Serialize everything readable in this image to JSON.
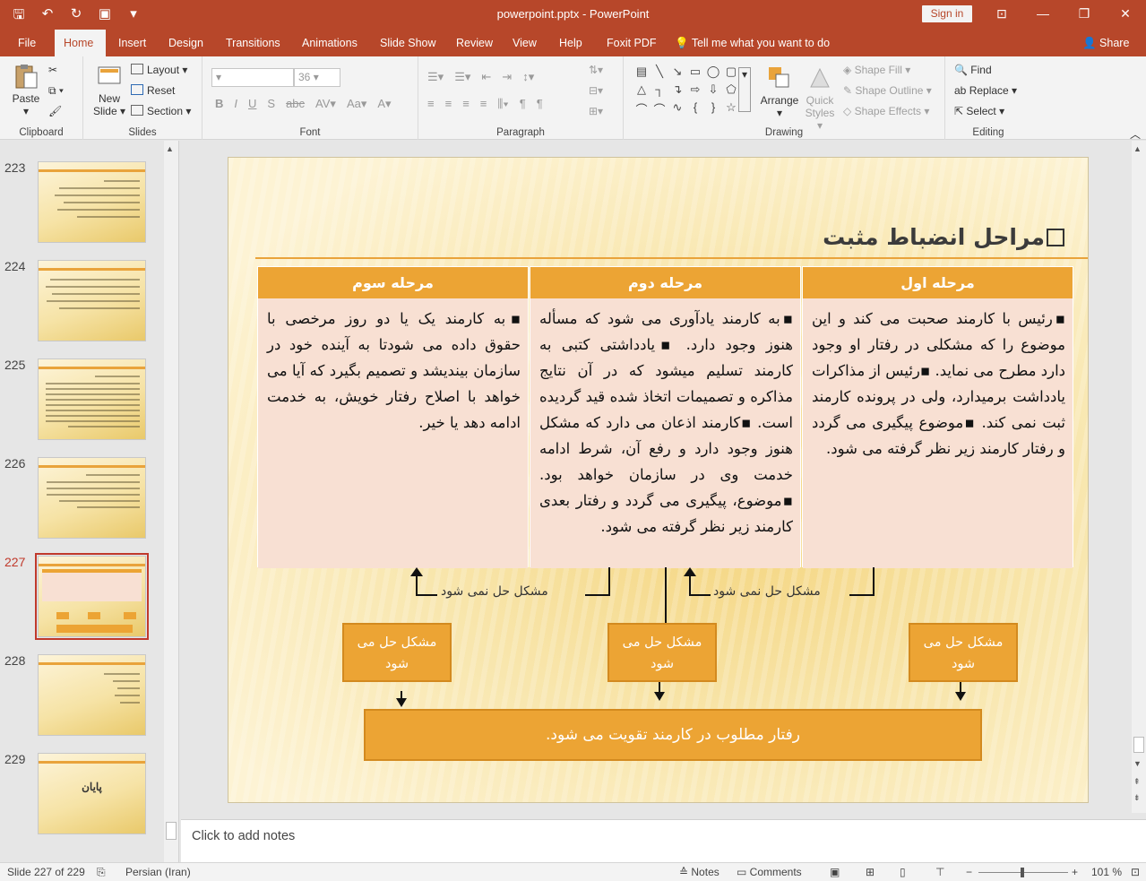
{
  "titlebar": {
    "title": "powerpoint.pptx  -  PowerPoint",
    "signin": "Sign in"
  },
  "tabs": [
    "File",
    "Home",
    "Insert",
    "Design",
    "Transitions",
    "Animations",
    "Slide Show",
    "Review",
    "View",
    "Help",
    "Foxit PDF"
  ],
  "active_tab": "Home",
  "tellme": "Tell me what you want to do",
  "share": "Share",
  "ribbon": {
    "clipboard": {
      "label": "Clipboard",
      "paste": "Paste"
    },
    "slides": {
      "label": "Slides",
      "new_slide": "New Slide",
      "layout": "Layout",
      "reset": "Reset",
      "section": "Section"
    },
    "font": {
      "label": "Font",
      "size": "36"
    },
    "paragraph": {
      "label": "Paragraph"
    },
    "drawing": {
      "label": "Drawing",
      "arrange": "Arrange",
      "quick_styles": "Quick Styles",
      "shape_fill": "Shape Fill",
      "shape_outline": "Shape Outline",
      "shape_effects": "Shape Effects"
    },
    "editing": {
      "label": "Editing",
      "find": "Find",
      "replace": "Replace",
      "select": "Select"
    }
  },
  "thumbnails": [
    {
      "num": "223"
    },
    {
      "num": "224"
    },
    {
      "num": "225"
    },
    {
      "num": "226"
    },
    {
      "num": "227"
    },
    {
      "num": "228"
    },
    {
      "num": "229",
      "title": "پایان"
    }
  ],
  "active_slide": "227",
  "slide": {
    "title": "مراحل انضباط مثبت",
    "columns": [
      {
        "header": "مرحله اول",
        "body": "▪رئیس با کارمند صحبت می کند و این موضوع را که مشکلی در رفتار او وجود دارد مطرح می نماید. ▪رئیس از مذاکرات یادداشت برمیدارد، ولی در پرونده کارمند ثبت نمی کند. ▪موضوع پیگیری می گردد و رفتار کارمند زیر نظر گرفته می شود."
      },
      {
        "header": "مرحله دوم",
        "body": "▪به کارمند یادآوری می شود که مسأله هنوز وجود دارد. ▪یادداشتی کتبی به کارمند تسلیم میشود که در آن نتایج مذاکره و تصمیمات اتخاذ شده قید گردیده است. ▪کارمند اذعان می دارد که مشکل هنوز وجود دارد و رفع آن، شرط ادامه خدمت وی در سازمان خواهد بود. ▪موضوع، پیگیری می گردد و رفتار بعدی کارمند زیر نظر گرفته می شود."
      },
      {
        "header": "مرحله سوم",
        "body": "▪به کارمند یک یا دو روز مرخصی با حقوق داده می شودتا به آینده خود در سازمان بیندیشد و تصمیم بگیرد که آیا می خواهد با اصلاح رفتار خویش، به خدمت ادامه دهد یا خیر."
      }
    ],
    "unsolved_1": "مشکل حل نمی شود",
    "unsolved_2": "مشکل حل نمی شود",
    "solved_boxes": [
      "مشکل حل می شود",
      "مشکل حل می شود",
      "مشکل حل می شود"
    ],
    "result": "رفتار مطلوب در کارمند تقویت می شود."
  },
  "notes_placeholder": "Click to add notes",
  "status": {
    "slide_info": "Slide 227 of 229",
    "language": "Persian (Iran)",
    "notes": "Notes",
    "comments": "Comments",
    "zoom": "101 %"
  }
}
